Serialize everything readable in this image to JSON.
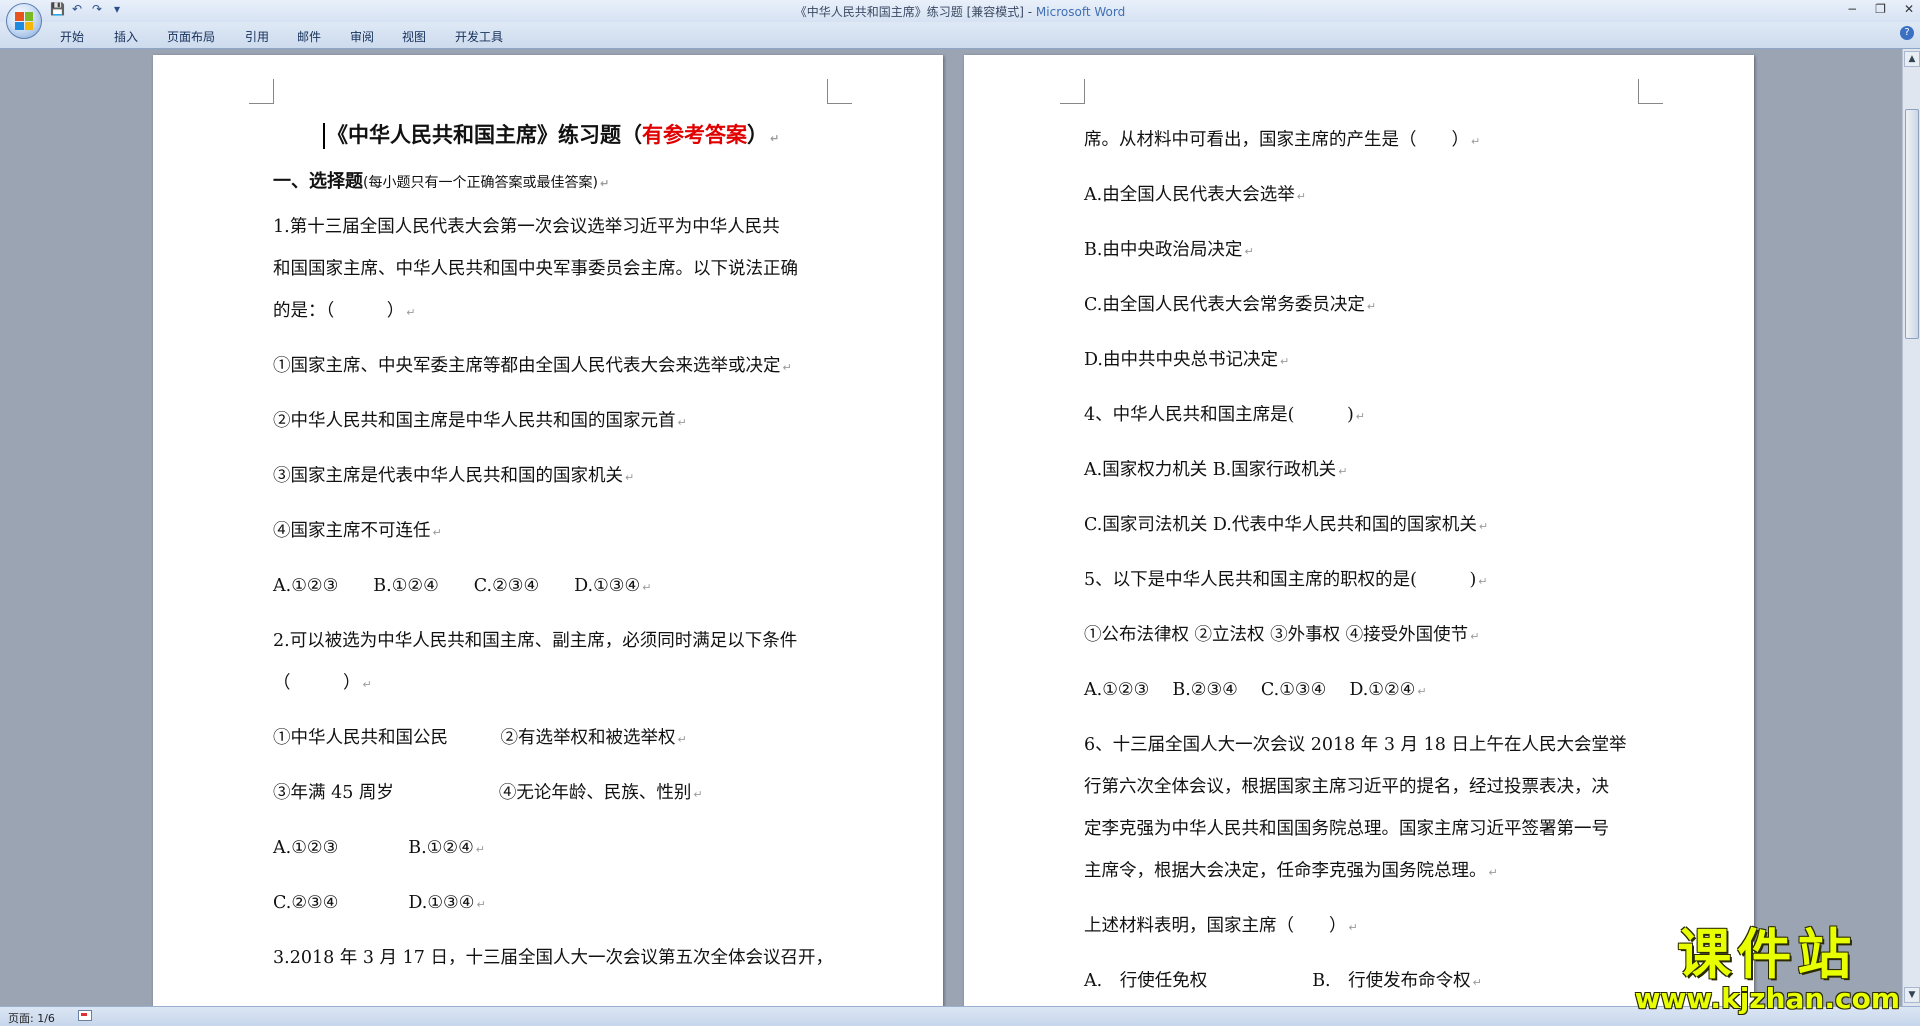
{
  "window": {
    "title": "《中华人民共和国主席》练习题 [兼容模式] - ",
    "app_name": "Microsoft Word",
    "controls": [
      "−",
      "❐",
      "✕"
    ]
  },
  "quick_access": {
    "icons": [
      "save-icon",
      "undo-icon",
      "redo-icon",
      "customize-icon"
    ],
    "glyphs": [
      "💾",
      "↶",
      "↷",
      "▾"
    ]
  },
  "ribbon": {
    "tabs": [
      "开始",
      "插入",
      "页面布局",
      "引用",
      "邮件",
      "审阅",
      "视图",
      "开发工具"
    ],
    "help": "?"
  },
  "left_page": {
    "title_prefix": "《中华人民共和国主席》练习题（",
    "title_red": "有参考答案",
    "title_suffix": "）",
    "section_heading": "一、选择题",
    "section_note": "(每小题只有一个正确答案或最佳答案)",
    "lines": [
      "1.第十三届全国人民代表大会第一次会议选举习近平为中华人民共",
      "和国国家主席、中华人民共和国中央军事委员会主席。以下说法正确",
      "的是：（　　　）",
      "①国家主席、中央军委主席等都由全国人民代表大会来选举或决定",
      "②中华人民共和国主席是中华人民共和国的国家元首",
      "③国家主席是代表中华人民共和国的国家机关",
      "④国家主席不可连任",
      "A.①②③　　B.①②④　　C.②③④　　D.①③④",
      "2.可以被选为中华人民共和国主席、副主席，必须同时满足以下条件",
      "（　　　）",
      "①中华人民共和国公民　　　②有选举权和被选举权",
      "③年满 45 周岁　　　　　　④无论年龄、民族、性别",
      "A.①②③　　　　B.①②④",
      "C.②③④　　　　D.①③④",
      "3.2018 年 3 月 17 日，十三届全国人大一次会议第五次全体会议召开，"
    ]
  },
  "right_page": {
    "lines": [
      "席。从材料中可看出，国家主席的产生是（　　）",
      "A.由全国人民代表大会选举",
      "B.由中央政治局决定",
      "C.由全国人民代表大会常务委员决定",
      "D.由中共中央总书记决定",
      "4、中华人民共和国主席是(　　　)",
      "A.国家权力机关 B.国家行政机关",
      "C.国家司法机关 D.代表中华人民共和国的国家机关",
      "5、以下是中华人民共和国主席的职权的是(　　　)",
      "①公布法律权 ②立法权 ③外事权 ④接受外国使节",
      "A.①②③　 B.②③④　 C.①③④　 D.①②④",
      "6、十三届全国人大一次会议 2018 年 3 月 18 日上午在人民大会堂举",
      "行第六次全体会议，根据国家主席习近平的提名，经过投票表决，决",
      "定李克强为中华人民共和国国务院总理。国家主席习近平签署第一号",
      "主席令，根据大会决定，任命李克强为国务院总理。",
      "上述材料表明，国家主席（　　）",
      "A.　行使任免权　　　　　　B.　行使发布命令权"
    ]
  },
  "paragraph_mark": "↵",
  "status_bar": {
    "page_info": "页面: 1/6"
  },
  "watermark": {
    "title": "课件站",
    "url": "www.kjzhan.com"
  },
  "scrollbar": {
    "up": "▲",
    "down": "▼"
  }
}
